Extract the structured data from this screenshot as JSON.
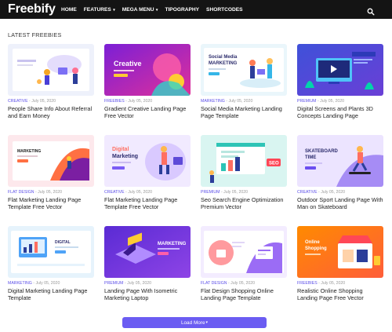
{
  "header": {
    "logo": "Freebify",
    "menu": [
      {
        "label": "HOME",
        "has_dropdown": false
      },
      {
        "label": "FEATURES",
        "has_dropdown": true
      },
      {
        "label": "MEGA MENU",
        "has_dropdown": true
      },
      {
        "label": "TIPOGRAPHY",
        "has_dropdown": false
      },
      {
        "label": "SHORTCODES",
        "has_dropdown": false
      }
    ],
    "search_icon": "search-icon"
  },
  "section_title": "LATEST FREEBIES",
  "posts": [
    {
      "category": "CREATIVE",
      "date": "July 05, 2020",
      "title": "People Share Info About Referral and Earn Money"
    },
    {
      "category": "FREEBIES",
      "date": "July 05, 2020",
      "title": "Gradient Creative Landing Page Free Vector"
    },
    {
      "category": "MARKETING",
      "date": "July 05, 2020",
      "title": "Social Media Marketing Landing Page Template"
    },
    {
      "category": "PREMIUM",
      "date": "July 05, 2020",
      "title": "Digital Screens and Plants 3D Concepts Landing Page"
    },
    {
      "category": "FLAT DESIGN",
      "date": "July 05, 2020",
      "title": "Flat Marketing Landing Page Template Free Vector"
    },
    {
      "category": "CREATIVE",
      "date": "July 05, 2020",
      "title": "Flat Marketing Landing Page Template Free Vector"
    },
    {
      "category": "PREMIUM",
      "date": "July 05, 2020",
      "title": "Seo Search Engine Optimization Premium Vector"
    },
    {
      "category": "CREATIVE",
      "date": "July 05, 2020",
      "title": "Outdoor Sport Landing Page With Man on Skateboard"
    },
    {
      "category": "MARKETING",
      "date": "July 05, 2020",
      "title": "Digital Marketing Landing Page Template"
    },
    {
      "category": "PREMIUM",
      "date": "July 05, 2020",
      "title": "Landing Page With Isometric Marketing Laptop"
    },
    {
      "category": "FLAT DESIGN",
      "date": "July 05, 2020",
      "title": "Flat Design Shopping Online Landing Page Template"
    },
    {
      "category": "FREEBIES",
      "date": "July 05, 2020",
      "title": "Realistic Online Shopping Landing Page Free Vector"
    }
  ],
  "thumb_text": {
    "t1": "Creative",
    "t2": "Social Media",
    "t2b": "MARKETING",
    "t4": "MARKETING",
    "t5a": "Digital",
    "t5b": "Marketing",
    "t6": "SEO",
    "t7a": "SKATEBOARD",
    "t7b": "TIME",
    "t8": "DIGITAL",
    "t9": "MARKETING",
    "t11a": "Online",
    "t11b": "Shopping"
  },
  "load_more": {
    "label": "Load More",
    "icon": "chevron-down-icon"
  },
  "colors": {
    "accent": "#5b4ee8",
    "nav_bg": "#141414",
    "button": "#6b5cf2"
  }
}
